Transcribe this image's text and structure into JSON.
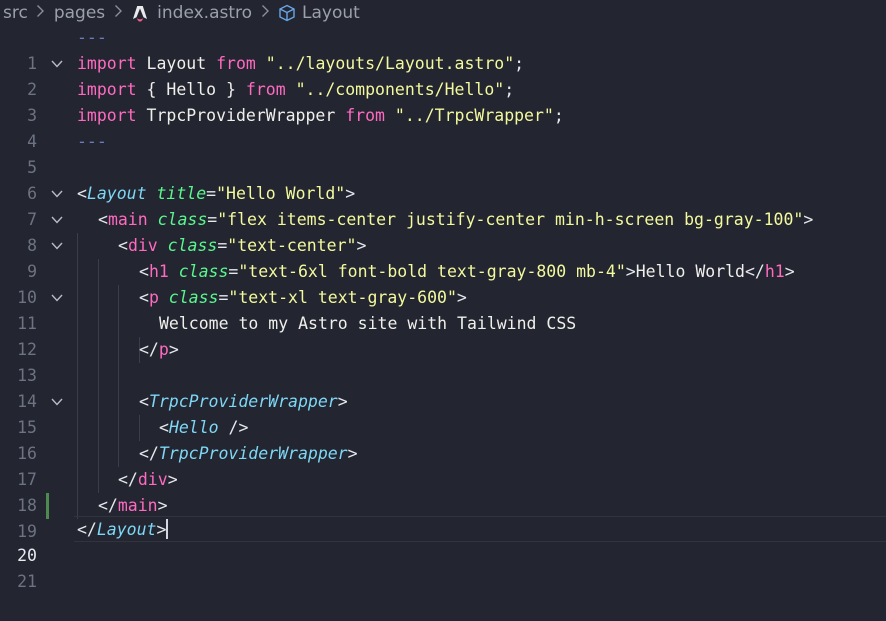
{
  "breadcrumb": {
    "items": [
      "src",
      "pages",
      "index.astro",
      "Layout"
    ],
    "separator": ">"
  },
  "editor": {
    "line_numbers": [
      "1",
      "2",
      "3",
      "4",
      "5",
      "6",
      "7",
      "8",
      "9",
      "10",
      "11",
      "12",
      "13",
      "14",
      "15",
      "16",
      "17",
      "18",
      "19",
      "20",
      "21"
    ],
    "active_line": "20",
    "lines": {
      "l1": {
        "fm": "---"
      },
      "l2": {
        "kw1": "import",
        "t1": " Layout ",
        "kw2": "from",
        "s1": " \"../layouts/Layout.astro\"",
        "p1": ";"
      },
      "l3": {
        "kw1": "import",
        "t1": " { Hello } ",
        "kw2": "from",
        "s1": " \"../components/Hello\"",
        "p1": ";"
      },
      "l4": {
        "kw1": "import",
        "t1": " TrpcProviderWrapper ",
        "kw2": "from",
        "s1": " \"../TrpcWrapper\"",
        "p1": ";"
      },
      "l5": {
        "fm": "---"
      },
      "l7": {
        "p1": "<",
        "tag": "Layout",
        "attr": " title",
        "eq": "=",
        "s1": "\"Hello World\"",
        "p2": ">"
      },
      "l8": {
        "p1": "<",
        "tag": "main",
        "attr": " class",
        "eq": "=",
        "s1": "\"flex items-center justify-center min-h-screen bg-gray-100\"",
        "p2": ">"
      },
      "l9": {
        "p1": "<",
        "tag": "div",
        "attr": " class",
        "eq": "=",
        "s1": "\"text-center\"",
        "p2": ">"
      },
      "l10": {
        "p1": "<",
        "tag": "h1",
        "attr": " class",
        "eq": "=",
        "s1": "\"text-6xl font-bold text-gray-800 mb-4\"",
        "p2": ">",
        "txt": "Hello World",
        "p3": "</",
        "tag2": "h1",
        "p4": ">"
      },
      "l11": {
        "p1": "<",
        "tag": "p",
        "attr": " class",
        "eq": "=",
        "s1": "\"text-xl text-gray-600\"",
        "p2": ">"
      },
      "l12": {
        "txt": "Welcome to my Astro site with Tailwind CSS"
      },
      "l13": {
        "p1": "</",
        "tag": "p",
        "p2": ">"
      },
      "l15": {
        "p1": "<",
        "tag": "TrpcProviderWrapper",
        "p2": ">"
      },
      "l16": {
        "p1": "<",
        "tag": "Hello",
        "p2": " />"
      },
      "l17": {
        "p1": "</",
        "tag": "TrpcProviderWrapper",
        "p2": ">"
      },
      "l18": {
        "p1": "</",
        "tag": "div",
        "p2": ">"
      },
      "l19": {
        "p1": "</",
        "tag": "main",
        "p2": ">"
      },
      "l20": {
        "p1": "</",
        "tag": "Layout",
        "p2": ">"
      }
    }
  },
  "colors": {
    "background": "#232530",
    "keyword": "#ff6ac1",
    "string": "#f3f99d",
    "component_tag": "#7ed7f5",
    "attribute": "#5af78e",
    "frontmatter": "#6d7ac0",
    "git_added": "#4e8a4f"
  }
}
